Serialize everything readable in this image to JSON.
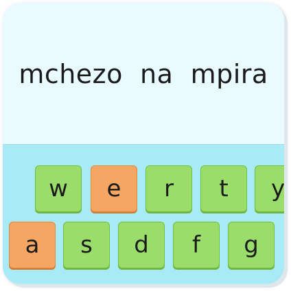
{
  "prompt": {
    "text": "mchezo  na  mpira"
  },
  "keyboard": {
    "row1": [
      {
        "label": "w",
        "state": "normal"
      },
      {
        "label": "e",
        "state": "highlighted"
      },
      {
        "label": "r",
        "state": "normal"
      },
      {
        "label": "t",
        "state": "normal"
      },
      {
        "label": "y",
        "state": "normal"
      }
    ],
    "row2": [
      {
        "label": "a",
        "state": "highlighted"
      },
      {
        "label": "s",
        "state": "normal"
      },
      {
        "label": "d",
        "state": "normal"
      },
      {
        "label": "f",
        "state": "normal"
      },
      {
        "label": "g",
        "state": "normal"
      }
    ]
  },
  "colors": {
    "prompt_background": "#e9fbff",
    "keyboard_background": "#a8ebf6",
    "key_normal": "#9bdd6a",
    "key_highlighted": "#f5a663"
  }
}
